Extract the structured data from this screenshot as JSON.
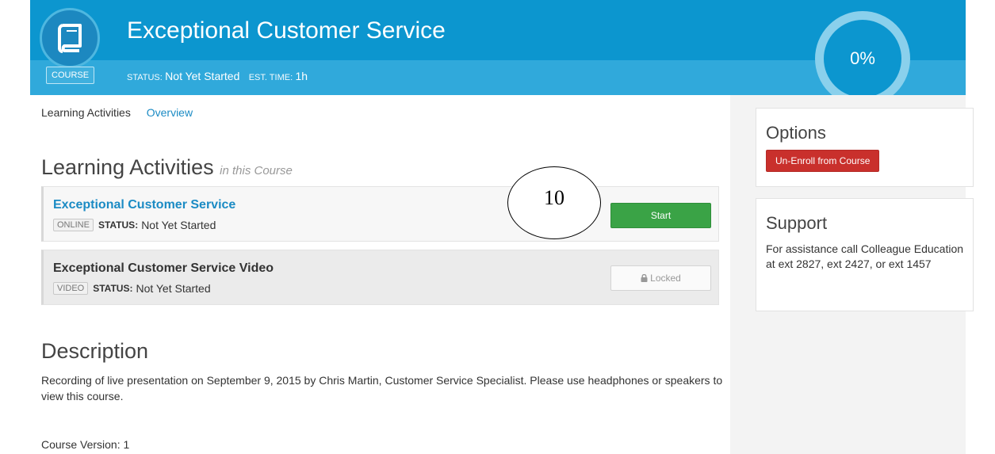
{
  "header": {
    "title": "Exceptional Customer Service",
    "badge": "COURSE",
    "status_label": "STATUS:",
    "status_value": "Not Yet Started",
    "time_label": "EST. TIME:",
    "time_value": "1h",
    "progress_text": "0%",
    "progress": 0,
    "icon": "book-icon"
  },
  "tabs": [
    {
      "label": "Learning Activities"
    },
    {
      "label": "Overview"
    }
  ],
  "activities_section": {
    "title": "Learning Activities",
    "subtitle": "in this Course"
  },
  "activities": [
    {
      "title": "Exceptional Customer Service",
      "type": "ONLINE",
      "status_label": "STATUS:",
      "status": "Not Yet Started",
      "button": "Start"
    },
    {
      "title": "Exceptional Customer Service Video",
      "type": "VIDEO",
      "status_label": "STATUS:",
      "status": "Not Yet Started",
      "button": "Locked",
      "button_icon": "lock-icon"
    }
  ],
  "annotation": "10",
  "description": {
    "title": "Description",
    "text": "Recording of live presentation on September 9, 2015 by Chris Martin, Customer Service Specialist. Please use headphones or speakers to view this course.",
    "version": "Course Version: 1"
  },
  "options": {
    "title": "Options",
    "button": "Un-Enroll from Course"
  },
  "support": {
    "title": "Support",
    "text": "For assistance call Colleague Education at ext 2827, ext 2427, or ext 1457"
  },
  "colors": {
    "header": "#0c96cf",
    "start": "#3aa346",
    "unenroll": "#c9302c",
    "link": "#1b8bc4"
  }
}
